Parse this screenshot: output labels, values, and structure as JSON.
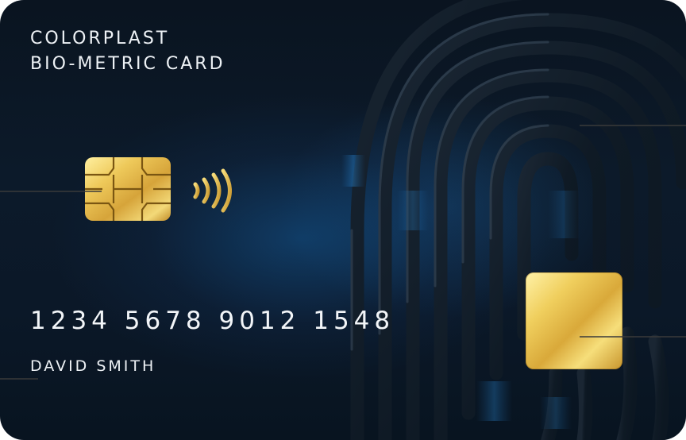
{
  "card": {
    "brand_line_1": "COLORPLAST",
    "brand_line_2": "BIO-METRIC CARD",
    "number": "1234 5678 9012 1548",
    "holder_name": "DAVID SMITH"
  },
  "icons": {
    "chip": "emv-chip-icon",
    "contactless": "contactless-icon",
    "fingerprint": "fingerprint-icon",
    "sensor": "fingerprint-sensor"
  },
  "colors": {
    "card_background": "#0b1828",
    "gold": "#e2b84a",
    "text": "#eef2f6",
    "callout_line": "#3a3a3a"
  }
}
